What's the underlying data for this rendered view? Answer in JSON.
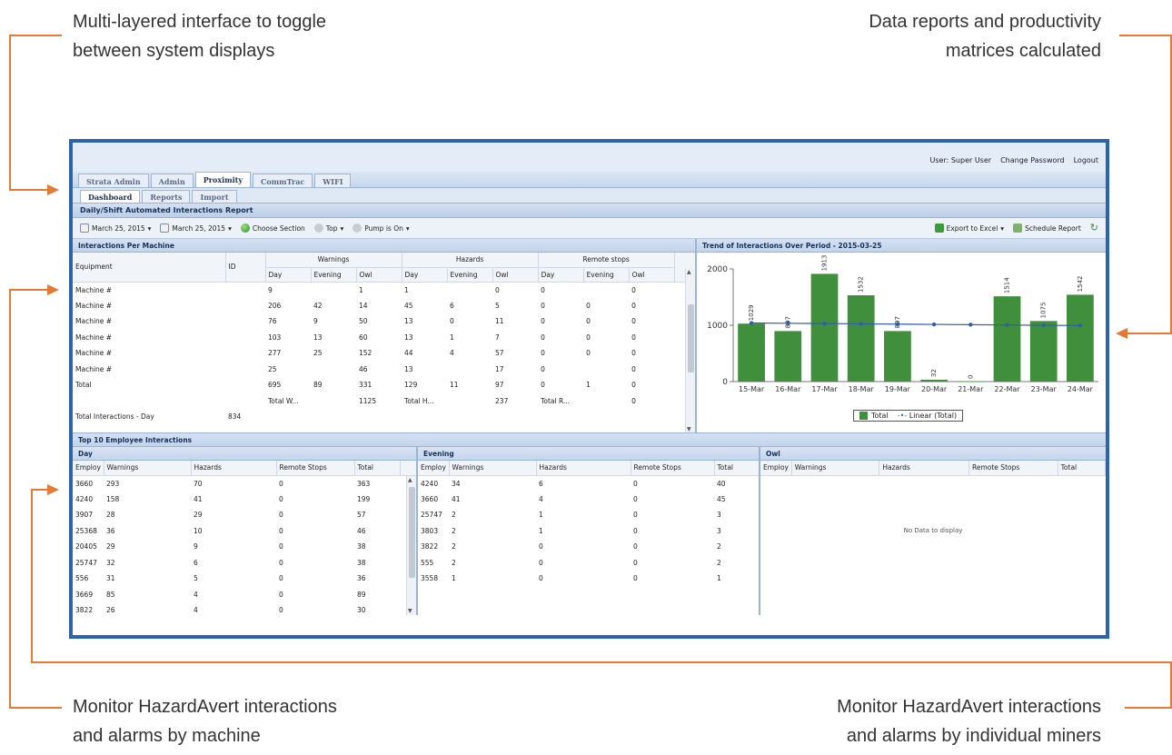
{
  "callouts": {
    "top_left": [
      "Multi-layered interface to toggle",
      "between system displays"
    ],
    "top_right": [
      "Data reports and productivity",
      "matrices calculated"
    ],
    "bottom_left": [
      "Monitor HazardAvert interactions",
      "and alarms by machine"
    ],
    "bottom_right": [
      "Monitor HazardAvert interactions",
      "and alarms by individual miners"
    ]
  },
  "colors": {
    "accent_orange": "#e47a33",
    "frame_blue": "#2b64ad",
    "bar_green": "#3f8f3c",
    "line_blue": "#2f5fa8"
  },
  "userbar": {
    "user": "User: Super User",
    "change_password": "Change Password",
    "logout": "Logout"
  },
  "main_tabs": [
    "Strata Admin",
    "Admin",
    "Proximity",
    "CommTrac",
    "WIFI"
  ],
  "sub_tabs": [
    "Dashboard",
    "Reports",
    "Import"
  ],
  "report_title": "Daily/Shift Automated Interactions Report",
  "toolbar": {
    "date_from": "March 25, 2015",
    "date_to": "March 25, 2015",
    "choose_section": "Choose Section",
    "top": "Top",
    "pump": "Pump is On",
    "export": "Export to Excel",
    "schedule": "Schedule Report"
  },
  "machine_panel": {
    "title": "Interactions Per Machine",
    "col_equipment": "Equipment",
    "col_id": "ID",
    "groups": [
      "Warnings",
      "Hazards",
      "Remote stops"
    ],
    "sub_cols": [
      "Day",
      "Evening",
      "Owl"
    ],
    "rows": [
      [
        "Machine #",
        "",
        "9",
        "",
        "1",
        "1",
        "",
        "0",
        "0",
        "",
        "0"
      ],
      [
        "Machine #",
        "",
        "206",
        "42",
        "14",
        "45",
        "6",
        "5",
        "0",
        "0",
        "0"
      ],
      [
        "Machine #",
        "",
        "76",
        "9",
        "50",
        "13",
        "0",
        "11",
        "0",
        "0",
        "0"
      ],
      [
        "Machine #",
        "",
        "103",
        "13",
        "60",
        "13",
        "1",
        "7",
        "0",
        "0",
        "0"
      ],
      [
        "Machine #",
        "",
        "277",
        "25",
        "152",
        "44",
        "4",
        "57",
        "0",
        "0",
        "0"
      ],
      [
        "Machine #",
        "",
        "25",
        "",
        "46",
        "13",
        "",
        "17",
        "0",
        "",
        "0"
      ],
      [
        "Total",
        "",
        "695",
        "89",
        "331",
        "129",
        "11",
        "97",
        "0",
        "1",
        "0"
      ],
      [
        "",
        "",
        "Total W...",
        "",
        "1125",
        "Total H...",
        "",
        "237",
        "Total R...",
        "",
        "0"
      ],
      [
        "Total Interactions - Day",
        "834",
        "",
        "",
        "",
        "",
        "",
        "",
        "",
        "",
        ""
      ]
    ]
  },
  "trend_panel": {
    "title": "Trend of Interactions Over Period - 2015-03-25"
  },
  "chart_data": {
    "type": "bar",
    "categories": [
      "15-Mar",
      "16-Mar",
      "17-Mar",
      "18-Mar",
      "19-Mar",
      "20-Mar",
      "21-Mar",
      "22-Mar",
      "23-Mar",
      "24-Mar"
    ],
    "series": [
      {
        "name": "Total",
        "values": [
          1029,
          897,
          1913,
          1532,
          897,
          32,
          0,
          1514,
          1075,
          1542
        ]
      },
      {
        "name": "Linear (Total)",
        "values": [
          1040,
          1035,
          1030,
          1025,
          1020,
          1015,
          1010,
          1005,
          1000,
          995
        ]
      }
    ],
    "data_labels": [
      "1029",
      "897",
      "1913",
      "1532",
      "897",
      "32",
      "0",
      "1514",
      "1075",
      "1542"
    ],
    "title": "",
    "xlabel": "",
    "ylabel": "",
    "ylim": [
      0,
      2000
    ],
    "yticks": [
      "0",
      "1000",
      "2000"
    ],
    "legend": [
      "Total",
      "Linear (Total)"
    ],
    "legend_position": "bottom",
    "grid": false
  },
  "employee_section": {
    "title": "Top 10 Employee Interactions",
    "headers": [
      "Employ",
      "Warnings",
      "Hazards",
      "Remote Stops",
      "Total"
    ],
    "day": {
      "label": "Day",
      "rows": [
        [
          "3660",
          "293",
          "70",
          "0",
          "363"
        ],
        [
          "4240",
          "158",
          "41",
          "0",
          "199"
        ],
        [
          "3907",
          "28",
          "29",
          "0",
          "57"
        ],
        [
          "25368",
          "36",
          "10",
          "0",
          "46"
        ],
        [
          "20405",
          "29",
          "9",
          "0",
          "38"
        ],
        [
          "25747",
          "32",
          "6",
          "0",
          "38"
        ],
        [
          "556",
          "31",
          "5",
          "0",
          "36"
        ],
        [
          "3669",
          "85",
          "4",
          "0",
          "89"
        ],
        [
          "3822",
          "26",
          "4",
          "0",
          "30"
        ]
      ]
    },
    "evening": {
      "label": "Evening",
      "rows": [
        [
          "4240",
          "34",
          "6",
          "0",
          "40"
        ],
        [
          "3660",
          "41",
          "4",
          "0",
          "45"
        ],
        [
          "25747",
          "2",
          "1",
          "0",
          "3"
        ],
        [
          "3803",
          "2",
          "1",
          "0",
          "3"
        ],
        [
          "3822",
          "2",
          "0",
          "0",
          "2"
        ],
        [
          "555",
          "2",
          "0",
          "0",
          "2"
        ],
        [
          "3558",
          "1",
          "0",
          "0",
          "1"
        ]
      ]
    },
    "owl": {
      "label": "Owl",
      "no_data": "No Data to display"
    }
  }
}
